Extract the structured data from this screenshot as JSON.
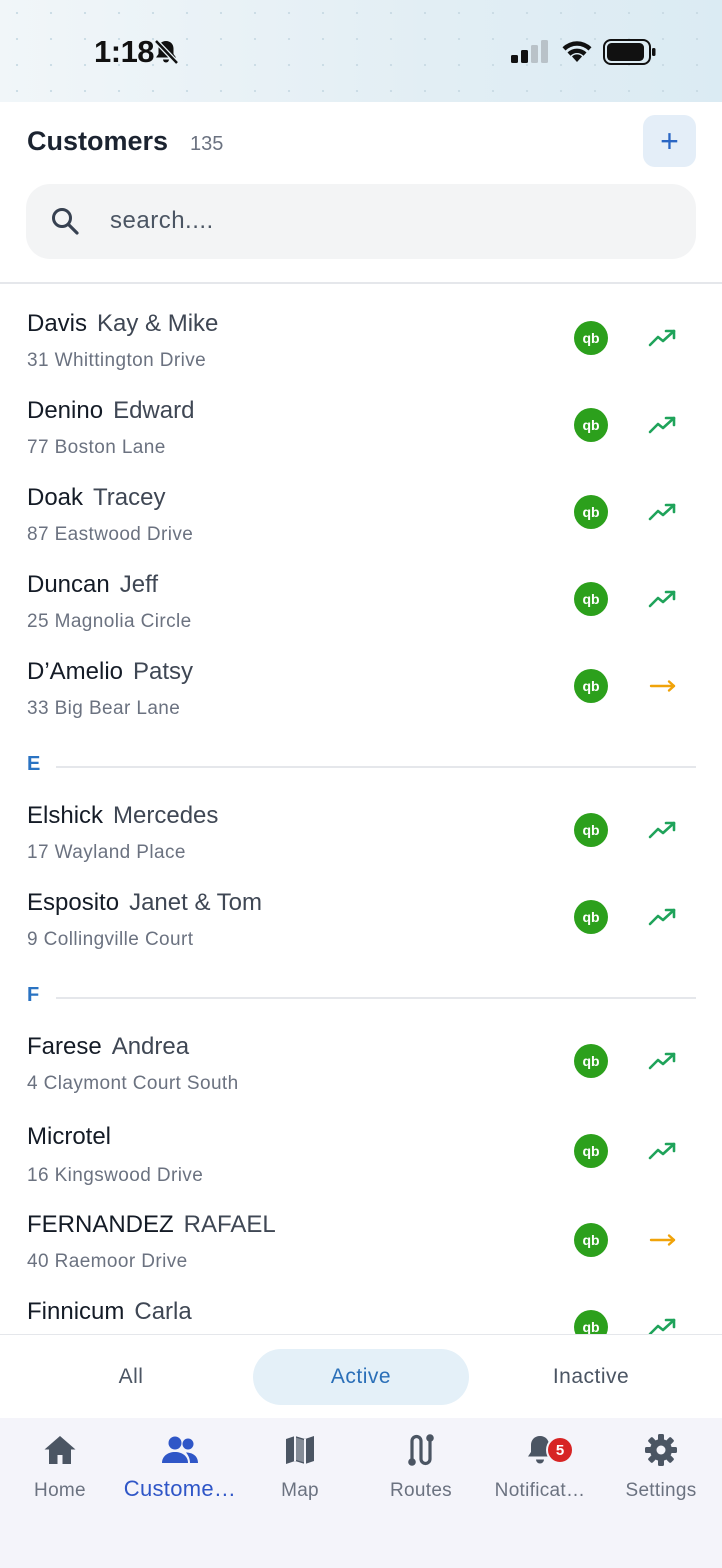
{
  "status_bar": {
    "time": "1:18"
  },
  "header": {
    "title": "Customers",
    "count": "135",
    "add_label": "+"
  },
  "search": {
    "placeholder": "search...."
  },
  "customers": [
    {
      "last": "Davis",
      "first": "Kay & Mike",
      "address": "31 Whittington Drive",
      "trend": "up"
    },
    {
      "last": "Denino",
      "first": "Edward",
      "address": "77 Boston Lane",
      "trend": "up"
    },
    {
      "last": "Doak",
      "first": "Tracey",
      "address": "87 Eastwood Drive",
      "trend": "up"
    },
    {
      "last": "Duncan",
      "first": "Jeff",
      "address": "25 Magnolia Circle",
      "trend": "up"
    },
    {
      "last": "D’Amelio",
      "first": "Patsy",
      "address": "33 Big Bear Lane",
      "trend": "flat"
    },
    {
      "last": "Elshick",
      "first": "Mercedes",
      "address": "17 Wayland Place",
      "trend": "up"
    },
    {
      "last": "Esposito",
      "first": "Janet & Tom",
      "address": "9 Collingville Court",
      "trend": "up"
    },
    {
      "last": "Farese",
      "first": "Andrea",
      "address": "4 Claymont Court South",
      "trend": "up"
    },
    {
      "last": "Microtel",
      "first": "",
      "address": "16 Kingswood Drive",
      "trend": "up"
    },
    {
      "last": "FERNANDEZ",
      "first": "RAFAEL",
      "address": "40 Raemoor Drive",
      "trend": "flat"
    },
    {
      "last": "Finnicum",
      "first": "Carla",
      "address": "",
      "trend": "up"
    }
  ],
  "sections": [
    "E",
    "F"
  ],
  "qb_label": "qb",
  "filters": {
    "all": "All",
    "active": "Active",
    "inactive": "Inactive",
    "selected": "Active"
  },
  "tabs": {
    "home": "Home",
    "customers": "Custome…",
    "map": "Map",
    "routes": "Routes",
    "notifications": "Notificat…",
    "settings": "Settings",
    "notification_count": "5"
  },
  "colors": {
    "qb_green": "#2ca01c",
    "trend_up": "#1fa35a",
    "trend_flat": "#f0a30a",
    "accent": "#2f56c7",
    "badge": "#d72424"
  }
}
